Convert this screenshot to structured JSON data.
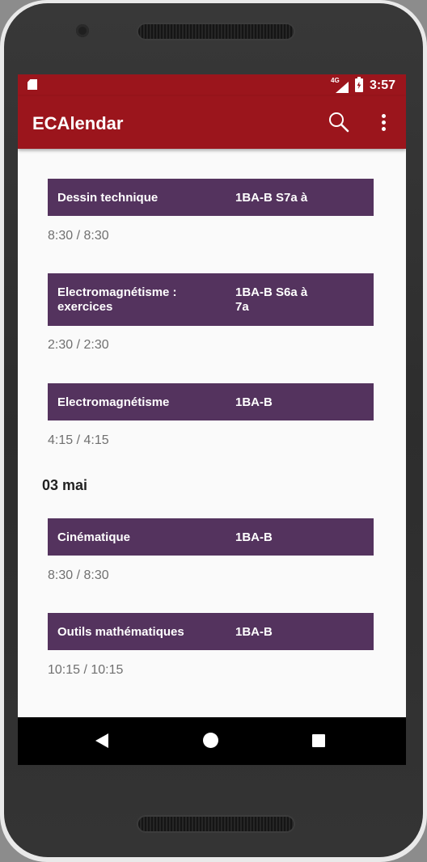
{
  "status_bar": {
    "network": "4G",
    "time": "3:57"
  },
  "app_bar": {
    "title": "ECAlendar",
    "actions": [
      "search-icon",
      "more-vert-icon"
    ]
  },
  "events": [
    {
      "name": "Dessin technique",
      "group": "1BA-B S7a à",
      "time": "8:30 / 8:30"
    },
    {
      "name": "Electromagnétisme : exercices",
      "group": "1BA-B S6a à 7a",
      "time": "2:30 / 2:30"
    },
    {
      "name": "Electromagnétisme",
      "group": "1BA-B",
      "time": "4:15 / 4:15"
    }
  ],
  "day_header": "03 mai",
  "events_after": [
    {
      "name": "Cinématique",
      "group": "1BA-B",
      "time": "8:30 / 8:30"
    },
    {
      "name": "Outils mathématiques",
      "group": "1BA-B",
      "time": "10:15 / 10:15"
    }
  ],
  "colors": {
    "primary": "#9b151c",
    "event_card": "#54335e",
    "background": "#fafafa",
    "time_text": "#707070"
  },
  "nav_bar": [
    "back-icon",
    "home-icon",
    "recents-icon"
  ]
}
